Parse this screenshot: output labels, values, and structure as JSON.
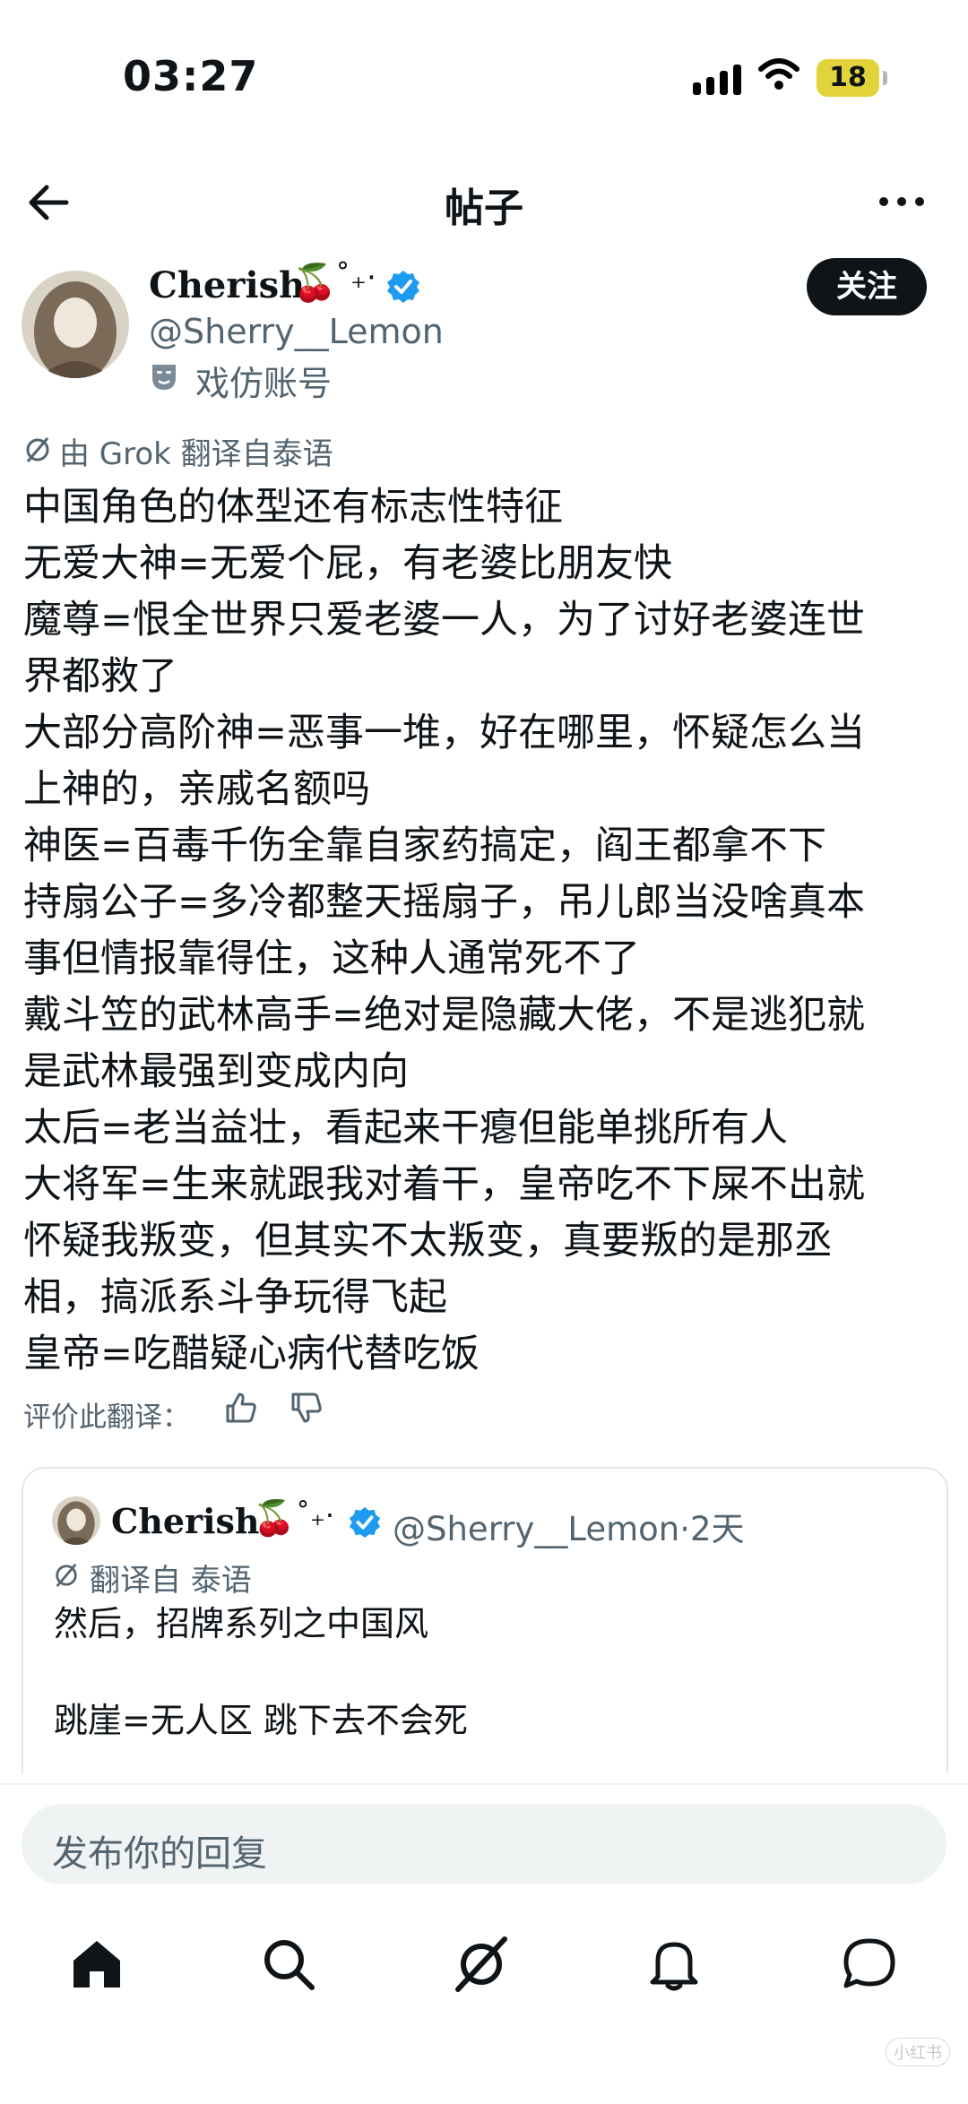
{
  "status_bar": {
    "time": "03:27",
    "battery": "18"
  },
  "header": {
    "title": "帖子"
  },
  "author": {
    "name": "Cherish",
    "emoji": "🍒",
    "sparkle": "˚₊·",
    "handle": "@Sherry__Lemon",
    "account_label": "戏仿账号",
    "follow_label": "关注"
  },
  "post": {
    "translation_note": "由 Grok 翻译自泰语",
    "lines": [
      "中国角色的体型还有标志性特征",
      "无爱大神=无爱个屁，有老婆比朋友快",
      "魔尊=恨全世界只爱老婆一人，为了讨好老婆连世",
      "界都救了",
      "大部分高阶神=恶事一堆，好在哪里，怀疑怎么当",
      "上神的，亲戚名额吗",
      "神医=百毒千伤全靠自家药搞定，阎王都拿不下",
      "持扇公子=多冷都整天摇扇子，吊儿郎当没啥真本",
      "事但情报靠得住，这种人通常死不了",
      "戴斗笠的武林高手=绝对是隐藏大佬，不是逃犯就",
      "是武林最强到变成内向",
      "太后=老当益壮，看起来干瘪但能单挑所有人",
      "大将军=生来就跟我对着干，皇帝吃不下屎不出就",
      "怀疑我叛变，但其实不太叛变，真要叛的是那丞",
      "相，搞派系斗争玩得飞起",
      "皇帝=吃醋疑心病代替吃饭"
    ],
    "rate_label": "评价此翻译："
  },
  "quote": {
    "name": "Cherish",
    "emoji": "🍒",
    "sparkle": "˚₊·",
    "handle_time": "@Sherry__Lemon·2天",
    "translation_note": "翻译自 泰语",
    "line1": "然后，招牌系列之中国风",
    "line2": "跳崖=无人区 跳下去不会死"
  },
  "reply": {
    "placeholder": "发布你的回复"
  },
  "tabs": [
    "home-icon",
    "search-icon",
    "grok-icon",
    "notifications-icon",
    "messages-icon"
  ],
  "watermark": "小红书",
  "colors": {
    "accent": "#1d9bf0",
    "text": "#0f1419",
    "secondary": "#536471",
    "battery": "#e3d33a"
  }
}
